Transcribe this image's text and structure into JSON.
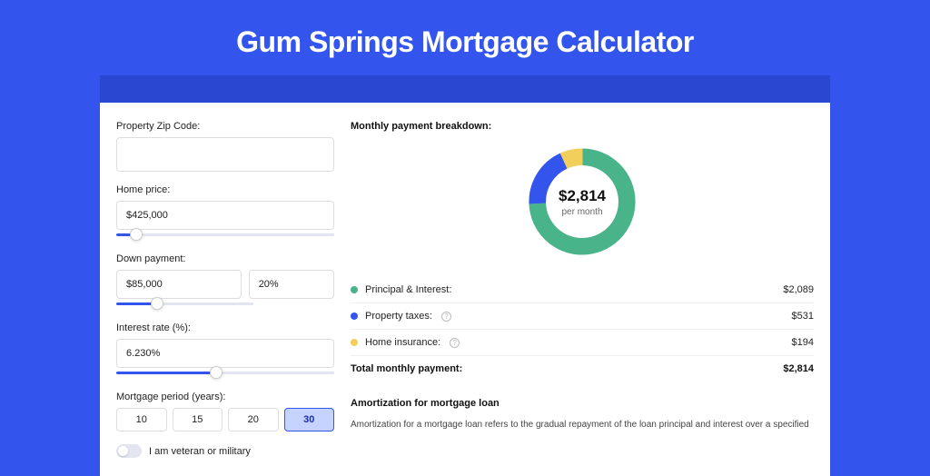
{
  "page_title": "Gum Springs Mortgage Calculator",
  "left": {
    "zip_label": "Property Zip Code:",
    "zip_value": "",
    "home_price_label": "Home price:",
    "home_price_value": "$425,000",
    "home_price_slider_pct": 9,
    "down_payment_label": "Down payment:",
    "down_payment_value": "$85,000",
    "down_payment_pct_value": "20%",
    "down_payment_slider_pct": 30,
    "interest_label": "Interest rate (%):",
    "interest_value": "6.230%",
    "interest_slider_pct": 46,
    "period_label": "Mortgage period (years):",
    "periods": [
      "10",
      "15",
      "20",
      "30"
    ],
    "period_selected": "30",
    "veteran_label": "I am veteran or military"
  },
  "breakdown": {
    "title": "Monthly payment breakdown:",
    "center_value": "$2,814",
    "center_sub": "per month",
    "items": [
      {
        "label": "Principal & Interest:",
        "value": "$2,089",
        "color": "#49b38a",
        "info": false
      },
      {
        "label": "Property taxes:",
        "value": "$531",
        "color": "#3355ee",
        "info": true
      },
      {
        "label": "Home insurance:",
        "value": "$194",
        "color": "#f2cf5b",
        "info": true
      }
    ],
    "total_label": "Total monthly payment:",
    "total_value": "$2,814"
  },
  "amort": {
    "title": "Amortization for mortgage loan",
    "text": "Amortization for a mortgage loan refers to the gradual repayment of the loan principal and interest over a specified"
  },
  "chart_data": {
    "type": "pie",
    "title": "Monthly payment breakdown",
    "categories": [
      "Principal & Interest",
      "Property taxes",
      "Home insurance"
    ],
    "values": [
      2089,
      531,
      194
    ],
    "colors": [
      "#49b38a",
      "#3355ee",
      "#f2cf5b"
    ],
    "total": 2814,
    "unit": "USD/month"
  }
}
